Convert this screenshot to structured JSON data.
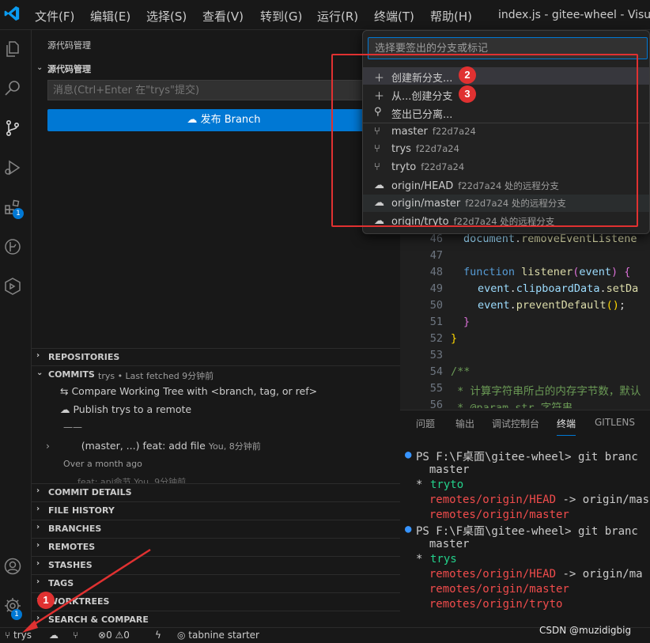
{
  "titlebar": {
    "menus": [
      "文件(F)",
      "编辑(E)",
      "选择(S)",
      "查看(V)",
      "转到(G)",
      "运行(R)",
      "终端(T)",
      "帮助(H)"
    ],
    "window_title": "index.js - gitee-wheel - Visual"
  },
  "activity": {
    "extensions_badge": "1",
    "settings_badge": "1"
  },
  "sidebar": {
    "view_title": "源代码管理",
    "scm_section_title": "源代码管理",
    "commit_placeholder": "消息(Ctrl+Enter 在\"trys\"提交)",
    "publish_button": "发布 Branch",
    "repositories_header": "REPOSITORIES",
    "commits_header": "COMMITS",
    "commits_meta": "trys • Last fetched 9分钟前",
    "commit_items": {
      "compare": "Compare Working Tree with <branch, tag, or ref>",
      "publish": "Publish trys to a remote",
      "divider": "——",
      "commit_refs": "(master, ...)",
      "commit_message": "feat: add file",
      "commit_author": "You, 8分钟前",
      "over_month": "Over a month ago",
      "partial_commit": "feat: api命节",
      "partial_time": "You, 9分钟前"
    },
    "sections": [
      "COMMIT DETAILS",
      "FILE HISTORY",
      "BRANCHES",
      "REMOTES",
      "STASHES",
      "TAGS",
      "WORKTREES",
      "SEARCH & COMPARE"
    ]
  },
  "editor": {
    "lines": [
      {
        "n": "46",
        "code": "document.removeEventListene"
      },
      {
        "n": "47",
        "code": ""
      },
      {
        "n": "48",
        "code": "function listener(event) {"
      },
      {
        "n": "49",
        "code": "event.clipboardData.setDa"
      },
      {
        "n": "50",
        "code": "event.preventDefault();"
      },
      {
        "n": "51",
        "code": "}"
      },
      {
        "n": "52",
        "code": "}"
      },
      {
        "n": "53",
        "code": ""
      },
      {
        "n": "54",
        "code": "/**"
      },
      {
        "n": "55",
        "code": " * 计算字符串所占的内存字节数，默认"
      },
      {
        "n": "56",
        "code": " * @param str 字符串"
      }
    ]
  },
  "panel": {
    "tabs": [
      "问题",
      "输出",
      "调试控制台",
      "终端",
      "GITLENS"
    ],
    "active_tab": "终端",
    "terminal": [
      {
        "kind": "prompt",
        "text": "PS F:\\F桌面\\gitee-wheel> git branc"
      },
      {
        "kind": "plain",
        "text": "  master"
      },
      {
        "kind": "current",
        "star": "* ",
        "text": "tryto"
      },
      {
        "kind": "remote",
        "text": "  remotes/origin/HEAD",
        "tail": " -> origin/mas"
      },
      {
        "kind": "remote",
        "text": "  remotes/origin/master"
      },
      {
        "kind": "prompt",
        "text": "PS F:\\F桌面\\gitee-wheel> git branc"
      },
      {
        "kind": "plain",
        "text": "  master"
      },
      {
        "kind": "current",
        "star": "* ",
        "text": "trys"
      },
      {
        "kind": "remote",
        "text": "  remotes/origin/HEAD",
        "tail": " -> origin/ma"
      },
      {
        "kind": "remote",
        "text": "  remotes/origin/master"
      },
      {
        "kind": "remote",
        "text": "  remotes/origin/tryto"
      }
    ]
  },
  "quickpick": {
    "placeholder": "选择要签出的分支或标记",
    "actions": [
      "创建新分支...",
      "从...创建分支",
      "签出已分离..."
    ],
    "branches": [
      {
        "name": "master",
        "hash": "f22d7a24"
      },
      {
        "name": "trys",
        "hash": "f22d7a24"
      },
      {
        "name": "tryto",
        "hash": "f22d7a24"
      }
    ],
    "remotes": [
      {
        "name": "origin/HEAD",
        "desc": "f22d7a24 处的远程分支"
      },
      {
        "name": "origin/master",
        "desc": "f22d7a24 处的远程分支"
      },
      {
        "name": "origin/tryto",
        "desc": "f22d7a24 处的远程分支"
      }
    ]
  },
  "annotations": {
    "badge1": "1",
    "badge2": "2",
    "badge3": "3"
  },
  "statusbar": {
    "branch": "trys",
    "errors": "0",
    "warnings": "0",
    "tabnine": "tabnine starter"
  },
  "watermark": "CSDN @muzidigbig",
  "colors": {
    "accent": "#0078d4",
    "annotation_red": "#e03131",
    "terminal_green": "#23d18b",
    "terminal_red": "#f14c4c"
  }
}
